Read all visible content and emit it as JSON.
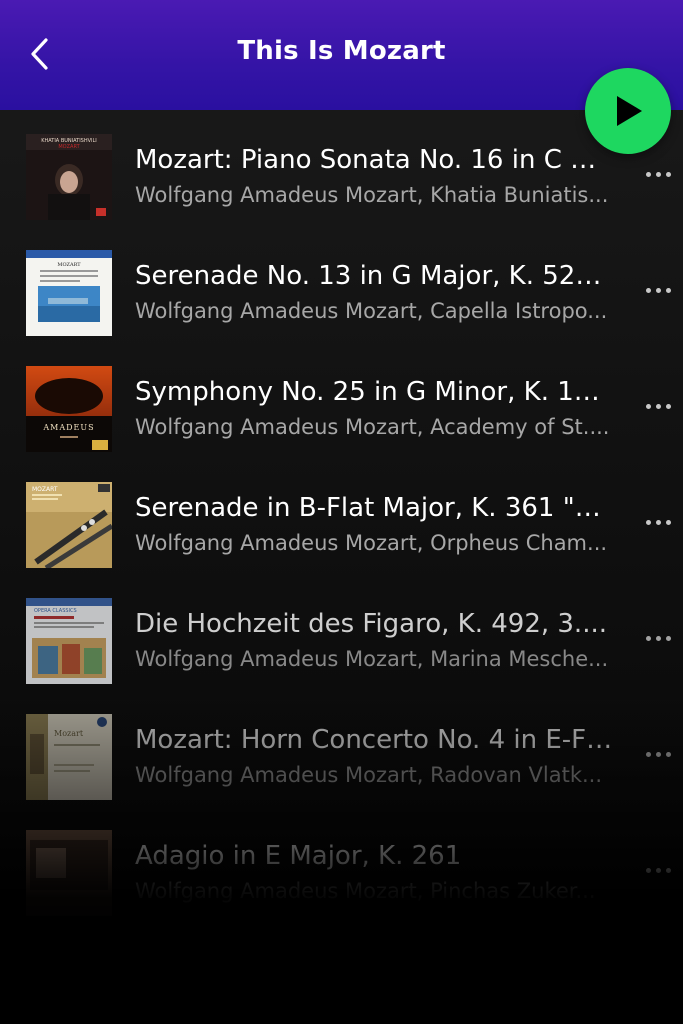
{
  "header": {
    "title": "This Is Mozart",
    "back_icon": "chevron-left-icon",
    "play_icon": "play-icon",
    "accent_color": "#1ed760",
    "header_color": "#3414a6"
  },
  "tracks": [
    {
      "title": "Mozart: Piano Sonata No. 16 in C M...",
      "subtitle": "Wolfgang Amadeus Mozart, Khatia Buniatis...",
      "cover_text": "KHATIA BUNIATISHVILI"
    },
    {
      "title": "Serenade No. 13 in G Major, K. 525, \"...",
      "subtitle": "Wolfgang Amadeus Mozart, Capella Istropo...",
      "cover_text": "MOZART"
    },
    {
      "title": "Symphony No. 25 in G Minor, K. 183:...",
      "subtitle": "Wolfgang Amadeus Mozart, Academy of St....",
      "cover_text": "AMADEUS"
    },
    {
      "title": "Serenade in B-Flat Major, K. 361 \"Gr...",
      "subtitle": "Wolfgang Amadeus Mozart, Orpheus Cham...",
      "cover_text": "MOZART"
    },
    {
      "title": "Die Hochzeit des Figaro, K. 492, 3....",
      "subtitle": "Wolfgang Amadeus Mozart, Marina Mesche...",
      "cover_text": "OPERA CLASSICS"
    },
    {
      "title": "Mozart: Horn Concerto No. 4 in E-Fl...",
      "subtitle": "Wolfgang Amadeus Mozart, Radovan Vlatk...",
      "cover_text": "Mozart"
    },
    {
      "title": "Adagio in E Major, K. 261",
      "subtitle": "Wolfgang Amadeus Mozart, Pinchas Zuker...",
      "cover_text": ""
    }
  ]
}
